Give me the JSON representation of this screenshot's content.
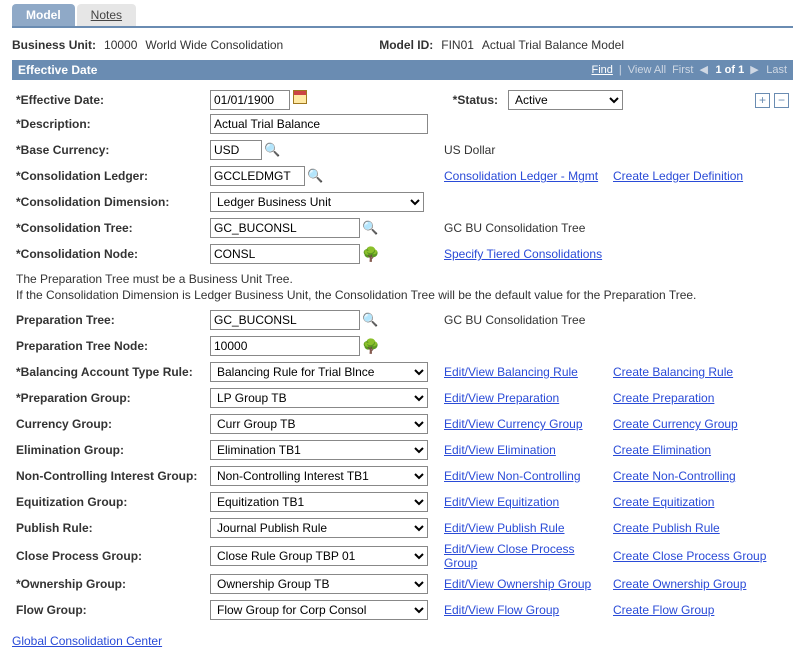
{
  "tabs": {
    "model": "Model",
    "notes": "Notes"
  },
  "header": {
    "bu_label": "Business Unit:",
    "bu_value": "10000",
    "bu_desc": "World Wide Consolidation",
    "model_id_label": "Model ID:",
    "model_id_value": "FIN01",
    "model_desc": "Actual Trial Balance Model"
  },
  "section": {
    "title": "Effective Date",
    "find": "Find",
    "view_all": "View All",
    "first": "First",
    "pager": "1 of 1",
    "last": "Last"
  },
  "fields": {
    "effdt_label": "*Effective Date:",
    "effdt_value": "01/01/1900",
    "status_label": "*Status:",
    "status_value": "Active",
    "descr_label": "*Description:",
    "descr_value": "Actual Trial Balance",
    "basecur_label": "*Base Currency:",
    "basecur_value": "USD",
    "basecur_desc": "US Dollar",
    "consled_label": "*Consolidation Ledger:",
    "consled_value": "GCCLEDMGT",
    "consled_link": "Consolidation Ledger - Mgmt",
    "create_ledger_link": "Create Ledger Definition",
    "consdim_label": "*Consolidation Dimension:",
    "consdim_value": "Ledger Business Unit",
    "constree_label": "*Consolidation Tree:",
    "constree_value": "GC_BUCONSL",
    "constree_desc": "GC BU Consolidation Tree",
    "consnode_label": "*Consolidation Node:",
    "consnode_value": "CONSL",
    "tiered_link": "Specify Tiered Consolidations",
    "note1": "The Preparation Tree must be a Business Unit Tree.",
    "note2": "If the Consolidation Dimension is Ledger Business Unit, the Consolidation Tree will be the default value for the Preparation Tree.",
    "preptree_label": "Preparation Tree:",
    "preptree_value": "GC_BUCONSL",
    "preptree_desc": "GC BU Consolidation Tree",
    "prepnode_label": "Preparation Tree Node:",
    "prepnode_value": "10000",
    "balrule_label": "*Balancing Account Type Rule:",
    "balrule_value": "Balancing Rule for Trial Blnce",
    "balrule_view": "Edit/View Balancing Rule",
    "balrule_create": "Create Balancing Rule",
    "prepgrp_label": "*Preparation Group:",
    "prepgrp_value": "LP Group TB",
    "prepgrp_view": "Edit/View Preparation",
    "prepgrp_create": "Create Preparation",
    "curgrp_label": "Currency Group:",
    "curgrp_value": "Curr Group TB",
    "curgrp_view": "Edit/View Currency Group",
    "curgrp_create": "Create Currency Group",
    "elimgrp_label": "Elimination Group:",
    "elimgrp_value": "Elimination TB1",
    "elimgrp_view": "Edit/View Elimination",
    "elimgrp_create": "Create Elimination",
    "ncigrp_label": "Non-Controlling Interest Group:",
    "ncigrp_value": "Non-Controlling Interest TB1",
    "ncigrp_view": "Edit/View Non-Controlling",
    "ncigrp_create": "Create Non-Controlling",
    "eqgrp_label": "Equitization Group:",
    "eqgrp_value": "Equitization TB1",
    "eqgrp_view": "Edit/View Equitization",
    "eqgrp_create": "Create Equitization",
    "pubrule_label": "Publish Rule:",
    "pubrule_value": "Journal Publish Rule",
    "pubrule_view": "Edit/View Publish Rule",
    "pubrule_create": "Create Publish Rule",
    "closegrp_label": "Close Process Group:",
    "closegrp_value": "Close Rule Group TBP 01",
    "closegrp_view": "Edit/View Close Process Group",
    "closegrp_create": "Create Close Process Group",
    "owngrp_label": "*Ownership Group:",
    "owngrp_value": "Ownership Group TB",
    "owngrp_view": "Edit/View Ownership Group",
    "owngrp_create": "Create Ownership Group",
    "flowgrp_label": "Flow Group:",
    "flowgrp_value": "Flow Group for Corp Consol",
    "flowgrp_view": "Edit/View Flow Group",
    "flowgrp_create": "Create Flow Group"
  },
  "footer": {
    "gcc_link": "Global Consolidation Center"
  }
}
